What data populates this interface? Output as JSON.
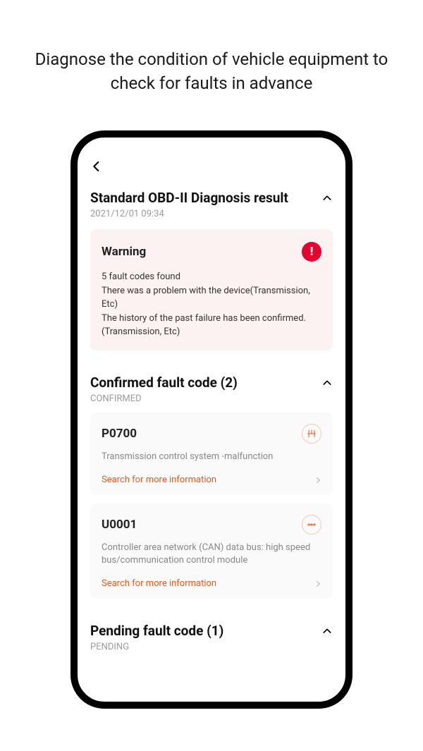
{
  "marketing_headline": "Diagnose the condition of vehicle equipment to check for faults in advance",
  "diagnosis": {
    "title": "Standard OBD-II Diagnosis result",
    "timestamp": "2021/12/01 09:34"
  },
  "warning": {
    "title": "Warning",
    "line1": "5 fault codes found",
    "line2": "There was a problem with the device(Transmission, Etc)",
    "line3": "The history of the past failure has been confirmed.(Transmission, Etc)"
  },
  "confirmed": {
    "title": "Confirmed fault code (2)",
    "sub": "CONFIRMED"
  },
  "faults": [
    {
      "code": "P0700",
      "desc": "Transmission control system -malfunction",
      "search": "Search for more information"
    },
    {
      "code": "U0001",
      "desc": "Controller area network (CAN) data bus: high speed bus/communication control module",
      "search": "Search for more information"
    }
  ],
  "pending": {
    "title": "Pending fault code (1)",
    "sub": "PENDING"
  }
}
